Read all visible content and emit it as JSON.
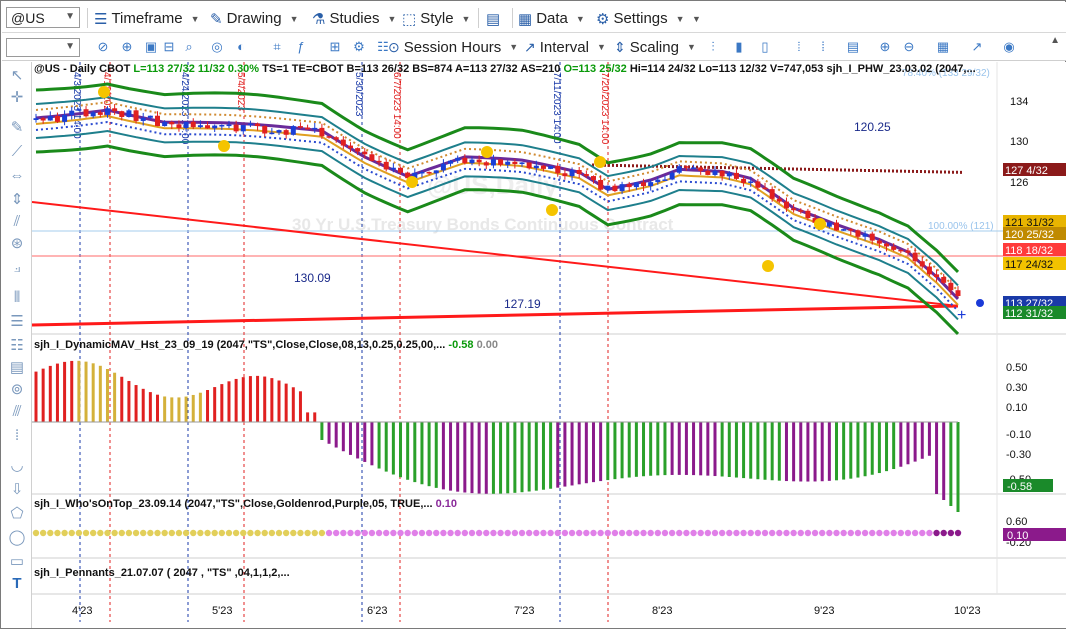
{
  "toolbar": {
    "symbol": "@US",
    "timeframe": "Timeframe",
    "drawing": "Drawing",
    "studies": "Studies",
    "style": "Style",
    "data": "Data",
    "settings": "Settings",
    "session_hours": "Session Hours",
    "interval": "Interval",
    "scaling": "Scaling"
  },
  "header": {
    "symbol_line": "@US - Daily  CBOT",
    "last": "L=113 27/32",
    "change": "11/32",
    "change_pct": "0.30%",
    "details": "TS=1  TE=CBOT  B=113 26/32  BS=874  A=113 27/32  AS=210",
    "open": "O=113 25/32",
    "stats": "Hi=114 24/32  Lo=113 12/32  V=747,053  sjh_I_PHW_23.03.02 (2047,..."
  },
  "watermark": {
    "symbol": "@US,Daily",
    "name": "30 Yr U.S.Treasury Bonds Continuous Contract"
  },
  "annotations": {
    "level_120_25": "120.25",
    "level_130_09": "130.09",
    "level_127_19": "127.19",
    "pct_label": "100.00% (121)",
    "top_pct": "78.40% (133 29/32)"
  },
  "date_markers": [
    "4/3/2023 14:00",
    "4/18/2023",
    "4/24/2023 14:00",
    "5/4/2023",
    "5/30/2023",
    "6/7/2023 14:00",
    "7/11/2023 14:00",
    "7/20/2023 14:00"
  ],
  "price_axis": {
    "ticks": [
      "134",
      "130",
      "126"
    ],
    "tags": [
      {
        "label": "127 4/32",
        "color": "#8b1a1a"
      },
      {
        "label": "121 31/32",
        "color": "#e8b400"
      },
      {
        "label": "120 25/32",
        "color": "#c08a00"
      },
      {
        "label": "118 18/32",
        "color": "#ff3b3b"
      },
      {
        "label": "117 24/32",
        "color": "#f2c200"
      },
      {
        "label": "113 27/32",
        "color": "#1a3aa8"
      },
      {
        "label": "112 31/32",
        "color": "#1a8a2a"
      }
    ]
  },
  "indicator1": {
    "name": "sjh_I_DynamicMAV_Hst_23_09_19 (2047,\"TS\",Close,Close,08,13,0.25,0.25,00,...",
    "value": "-0.58",
    "value2": "0.00",
    "ticks": [
      "0.50",
      "0.30",
      "0.10",
      "-0.10",
      "-0.30",
      "-0.50"
    ],
    "tag": "-0.58",
    "positive_colors": [
      "#d4b13a",
      "#e02020"
    ],
    "negative_colors": [
      "#2aa02a",
      "#8b1a8b"
    ]
  },
  "indicator2": {
    "name": "sjh_I_Who'sOnTop_23.09.14 (2047,\"TS\",Close,Goldenrod,Purple,05,  TRUE,...",
    "value": "0.10",
    "ticks": [
      "0.60",
      "-0.20"
    ],
    "tag": "0.10"
  },
  "indicator3": {
    "name": "sjh_I_Pennants_21.07.07 (  2047 ,  \"TS\" ,04,1,1,2,..."
  },
  "time_axis": [
    "4'23",
    "5'23",
    "6'23",
    "7'23",
    "8'23",
    "9'23",
    "10'23"
  ],
  "colors": {
    "bull_candle": "#1a3fd6",
    "bear_candle": "#e02020",
    "band_green": "#1a8a1a",
    "band_teal": "#1e7f8c",
    "ma_purple": "#6a2a9a",
    "ma_gold": "#e0a020",
    "trend_line": "#ff1a1a"
  }
}
